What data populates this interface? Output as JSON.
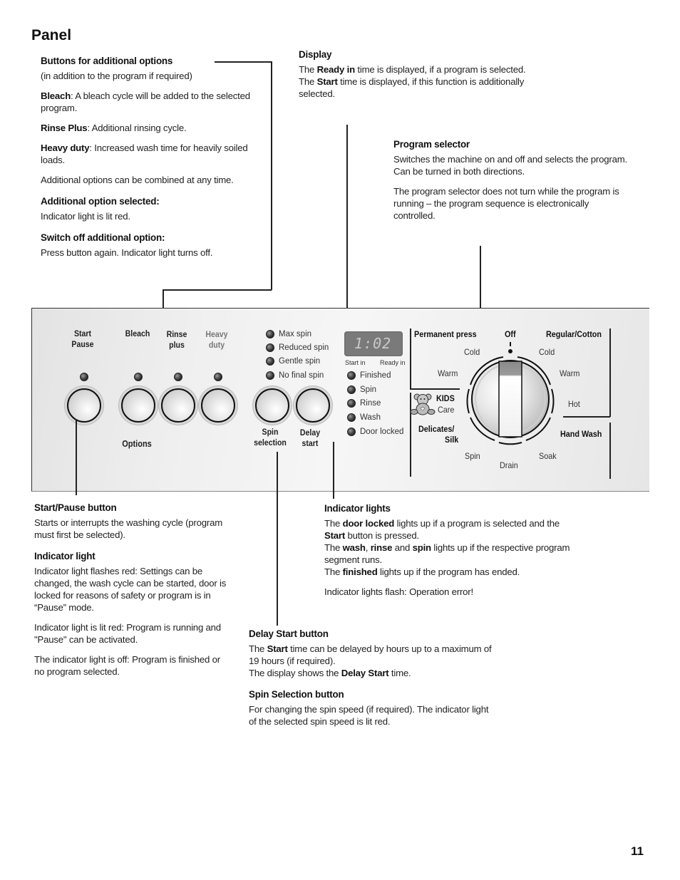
{
  "page": {
    "title": "Panel",
    "page_number": "11"
  },
  "options_callout": {
    "heading": "Buttons for additional options",
    "subtitle": "(in addition to the program if required)",
    "bleach_term": "Bleach",
    "bleach_text": ": A bleach cycle will be added to the selected program.",
    "rinse_term": "Rinse Plus",
    "rinse_text": ": Additional rinsing cycle.",
    "heavy_term": "Heavy duty",
    "heavy_text": ": Increased wash time for heavily soiled loads.",
    "combine_text": "Additional options can be combined at any time.",
    "selected_heading": "Additional option selected:",
    "selected_text": "Indicator light is lit red.",
    "switch_off_heading": "Switch off additional option:",
    "switch_off_text": "Press button again. Indicator light turns off."
  },
  "display_callout": {
    "heading": "Display",
    "t1": "The ",
    "b1": "Ready in",
    "t2": " time is displayed, if a program is selected.",
    "t3": "The ",
    "b2": "Start",
    "t4": "  time is displayed, if this function is additionally selected."
  },
  "program_selector_callout": {
    "heading": "Program selector",
    "p1": "Switches the machine on and off and selects the program. Can be turned in both directions.",
    "p2": "The program selector does not turn while the program is running – the program sequence is electronically controlled."
  },
  "panel": {
    "buttons": [
      {
        "label_line1": "Start",
        "label_line2": "Pause"
      },
      {
        "label_line1": "Bleach",
        "label_line2": ""
      },
      {
        "label_line1": "Rinse",
        "label_line2": "plus"
      },
      {
        "label_line1": "Heavy",
        "label_line2": "duty"
      }
    ],
    "options_group_label": "Options",
    "spin_options": [
      "Max spin",
      "Reduced spin",
      "Gentle spin",
      "No final spin"
    ],
    "spin_button": {
      "line1": "Spin",
      "line2": "selection"
    },
    "delay_button": {
      "line1": "Delay",
      "line2": "start"
    },
    "display": {
      "value": "1:02",
      "label_left": "Start in",
      "label_right": "Ready in"
    },
    "status_lights": [
      "Finished",
      "Spin",
      "Rinse",
      "Wash",
      "Door locked"
    ],
    "dial": {
      "permanent_press": "Permanent press",
      "off": "Off",
      "regular_cotton": "Regular/Cotton",
      "pp_cold": "Cold",
      "pp_warm": "Warm",
      "rc_cold": "Cold",
      "rc_warm": "Warm",
      "rc_hot": "Hot",
      "kids": "KIDS",
      "care": "Care",
      "delicates": "Delicates/",
      "silk": "Silk",
      "hand_wash": "Hand Wash",
      "spin": "Spin",
      "drain": "Drain",
      "soak": "Soak"
    }
  },
  "start_pause_callout": {
    "heading": "Start/Pause button",
    "text": "Starts or interrupts the washing cycle (program must first be selected).",
    "indicator_heading": "Indicator light",
    "p1": "Indicator light flashes red: Settings can be changed, the wash cycle can be started, door is locked for reasons of safety or program is in “Pause” mode.",
    "p2": "Indicator light is lit red: Program is running and \"Pause\" can be activated.",
    "p3": "The indicator light is off: Program is finished or no program selected."
  },
  "indicator_lights_callout": {
    "heading": "Indicator lights",
    "a1": "The ",
    "door_locked": "door locked",
    "a2": " lights up if a program is selected and the",
    "start": "Start",
    "a3": " button is pressed.",
    "b1": "The ",
    "wash": "wash",
    "b2": ", ",
    "rinse": "rinse",
    "b3": " and ",
    "spin": "spin",
    "b4": " lights up if the respective program segment runs.",
    "c1": "The ",
    "finished": "finished",
    "c2": " lights up if the program has ended.",
    "flash_text": "Indicator lights flash: Operation error!"
  },
  "delay_start_callout": {
    "heading": "Delay Start button",
    "a1": "The ",
    "start": "Start",
    "a2": " time can be delayed by hours up to a maximum of 19 hours (if required).",
    "b1": "The display shows the ",
    "delay_start": "Delay Start",
    "b2": " time."
  },
  "spin_selection_callout": {
    "heading": "Spin Selection button",
    "text": "For changing the spin speed (if required). The indicator light of the selected spin speed is lit red."
  }
}
